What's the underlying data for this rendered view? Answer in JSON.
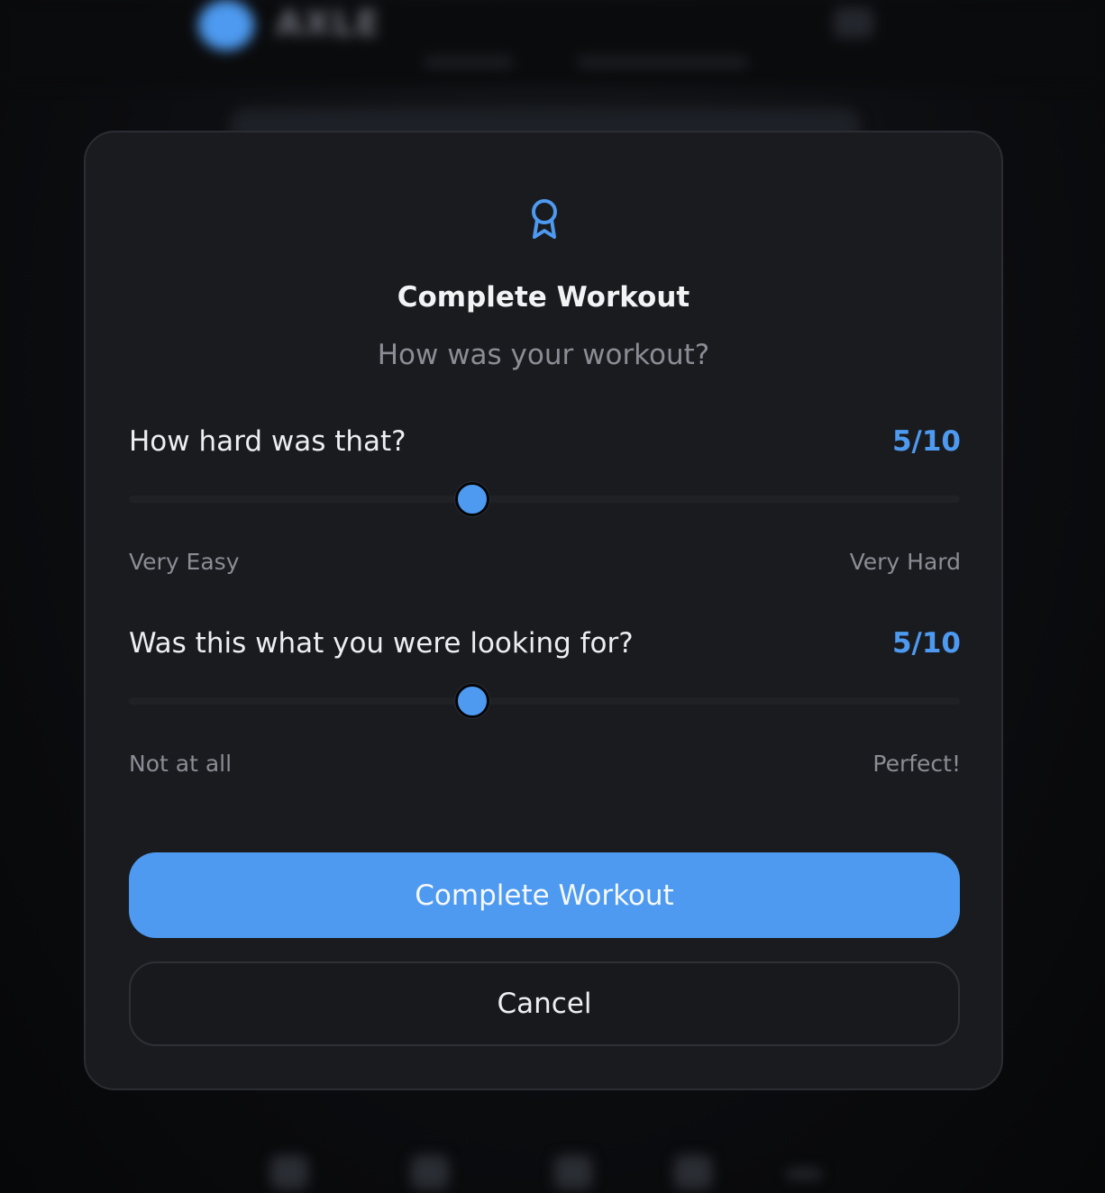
{
  "background": {
    "brand": "AXLE"
  },
  "modal": {
    "icon": "award-icon",
    "title": "Complete Workout",
    "subtitle": "How was your workout?",
    "questions": [
      {
        "label": "How hard was that?",
        "value": 5,
        "max": 10,
        "score_text": "5/10",
        "min_label": "Very Easy",
        "max_label": "Very Hard"
      },
      {
        "label": "Was this what you were looking for?",
        "value": 5,
        "max": 10,
        "score_text": "5/10",
        "min_label": "Not at all",
        "max_label": "Perfect!"
      }
    ],
    "primary_button": "Complete Workout",
    "cancel_button": "Cancel"
  },
  "colors": {
    "accent": "#4d9af0",
    "modal_background": "#1a1b1f",
    "page_background": "#0b0c0e"
  }
}
